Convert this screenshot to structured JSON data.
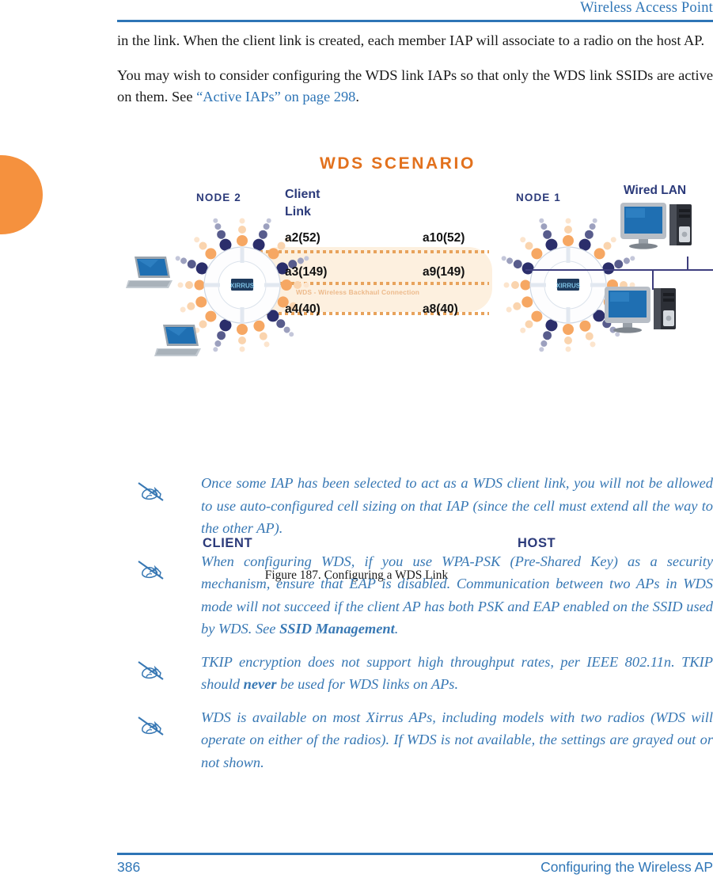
{
  "header": {
    "title": "Wireless Access Point",
    "rule_color": "#2E75B6"
  },
  "body": {
    "paragraph_1": "in the link. When the client link is created, each member IAP will associate to a radio on the host AP.",
    "paragraph_2_before": "You may wish to consider configuring the WDS link IAPs so that only the WDS link SSIDs are active on them. See ",
    "paragraph_2_link": "“Active IAPs” on page 298",
    "paragraph_2_after": "."
  },
  "figure": {
    "caption": "Figure 187. Configuring a WDS Link",
    "diagram_title": "WDS SCENARIO",
    "node_left": "NODE 2",
    "node_right": "NODE 1",
    "wired_lan": "Wired LAN",
    "client_link": "Client Link",
    "backhaul_caption": "WDS - Wireless Backhaul Connection",
    "radios_left": [
      "a2(52)",
      "a3(149)",
      "a4(40)"
    ],
    "radios_right": [
      "a10(52)",
      "a9(149)",
      "a8(40)"
    ],
    "endpoint_left": "CLIENT",
    "endpoint_right": "HOST",
    "colors": {
      "title_orange": "#E2711D",
      "label_navy": "#2B3A7A",
      "band_fill": "#FDF0DF",
      "band_dots": "#E8A35C",
      "beam_orange": "#F0712A",
      "beam_pale": "#F8C89A",
      "beam_navy": "#2B2E6B",
      "lan_wire": "#3E3E7E",
      "screen_blue": "#1F6FB2"
    }
  },
  "notes": [
    {
      "icon": "note-pencil-icon",
      "segments": [
        {
          "text": "Once some IAP has been selected to act as a WDS client link, you will not be allowed to use auto-configured cell sizing on that IAP (since the cell must extend all the way to the other AP).",
          "bold": false
        }
      ]
    },
    {
      "icon": "note-pencil-icon",
      "segments": [
        {
          "text": "When configuring WDS, if you use WPA-PSK (Pre-Shared Key) as a security mechanism, ensure that EAP is disabled. Communication between two APs in WDS mode will not succeed if the client AP has both PSK and EAP enabled on the SSID used by WDS. See ",
          "bold": false
        },
        {
          "text": "SSID Management",
          "bold": true
        },
        {
          "text": ".",
          "bold": false
        }
      ]
    },
    {
      "icon": "note-pencil-icon",
      "segments": [
        {
          "text": "TKIP encryption does not support high throughput rates, per IEEE 802.11n. TKIP should ",
          "bold": false
        },
        {
          "text": "never",
          "bold": true
        },
        {
          "text": " be used for WDS links on APs.",
          "bold": false
        }
      ]
    },
    {
      "icon": "note-pencil-icon",
      "segments": [
        {
          "text": "WDS is available on most Xirrus APs, including models with two radios (WDS will operate on either of the radios). If WDS is not available, the settings are grayed out or not shown.",
          "bold": false
        }
      ]
    }
  ],
  "footer": {
    "page_number": "386",
    "chapter": "Configuring the Wireless AP",
    "rule_color": "#2E75B6"
  },
  "decoration": {
    "edge_tab_color": "#F5913E"
  }
}
